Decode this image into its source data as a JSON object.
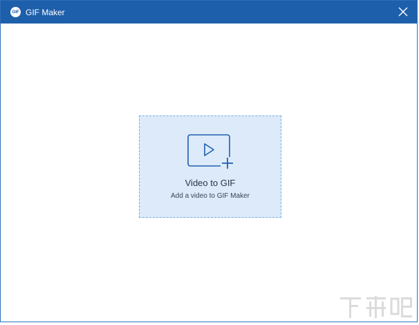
{
  "window": {
    "title": "GIF Maker",
    "logo_text": "GIF",
    "close_icon": "close-icon"
  },
  "dropzone": {
    "title": "Video to GIF",
    "subtitle": "Add a video to GIF Maker",
    "icon": "add-video-icon"
  },
  "colors": {
    "titlebar": "#1e5fab",
    "dropzone_bg": "#dceafa",
    "dropzone_border": "#79aee3",
    "icon_stroke": "#1e5fab"
  },
  "watermark": {
    "text": "下载吧"
  }
}
